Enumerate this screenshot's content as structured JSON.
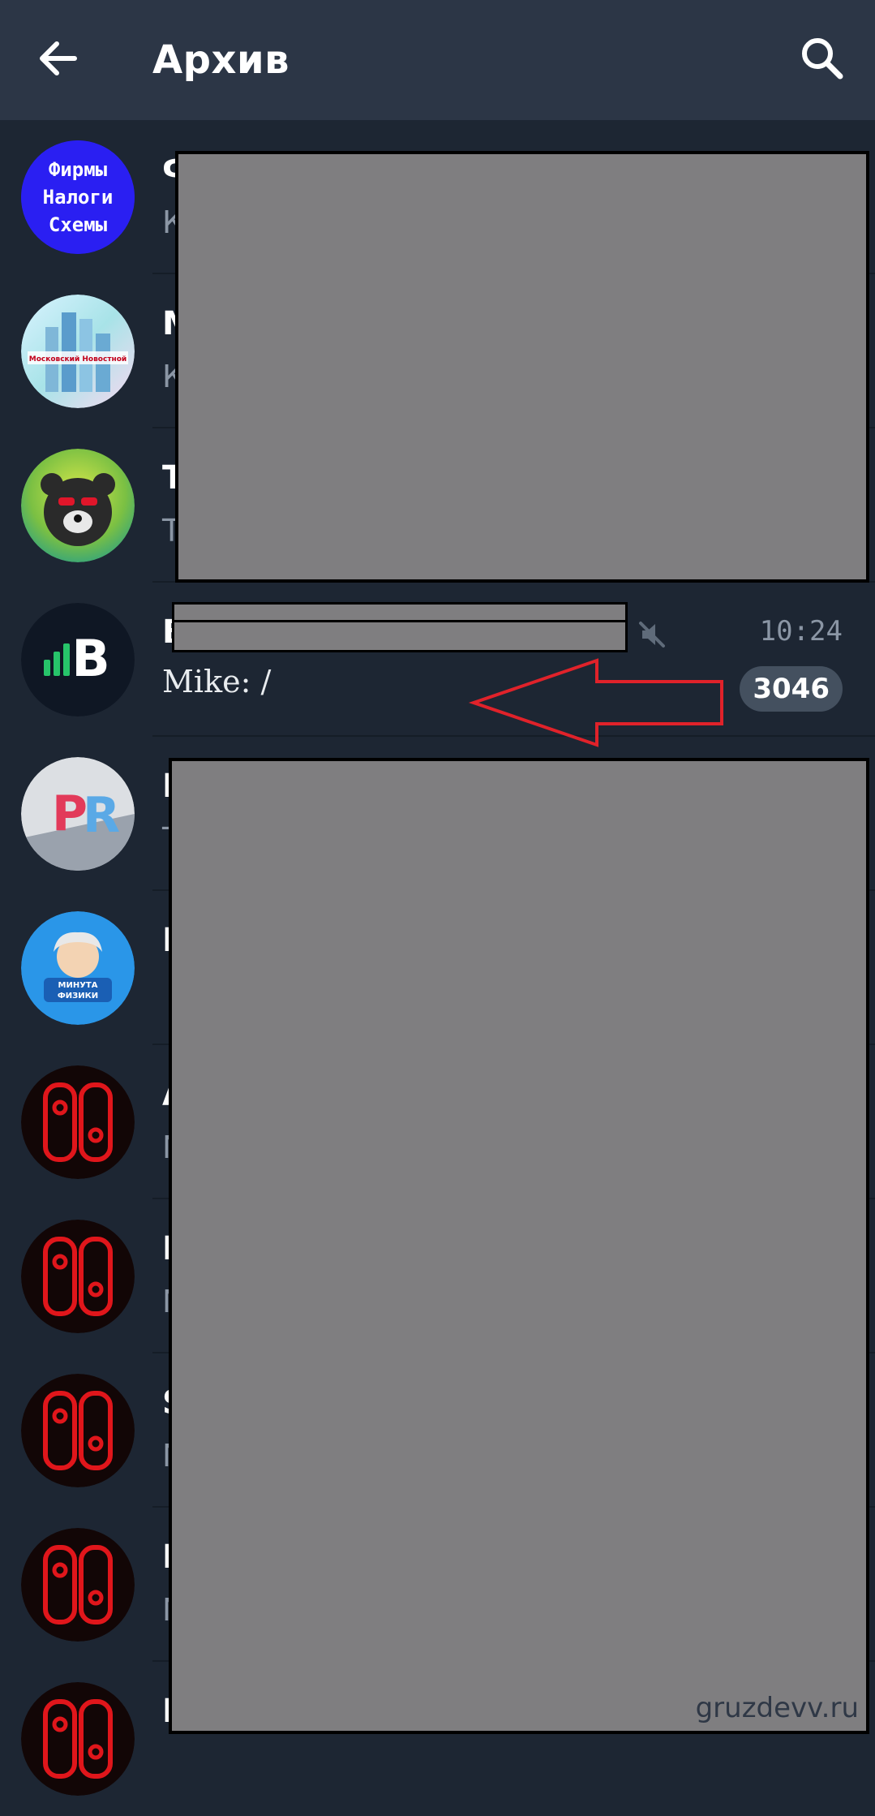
{
  "header": {
    "title": "Архив",
    "back_icon": "arrow-left-icon",
    "search_icon": "search-icon"
  },
  "chats": [
    {
      "avatar_lines": [
        "Фирмы",
        "Налоги",
        "Схемы"
      ],
      "avatar_color": "#2a1ff2",
      "title_initial": "Ф",
      "preview_initial": "К"
    },
    {
      "avatar_text": "Московский Новостной",
      "title_initial": "М",
      "preview_initial": "К"
    },
    {
      "avatar_icon": "bear-icon",
      "title_initial": "T",
      "preview_initial": "T"
    },
    {
      "avatar_letter": "B",
      "title_initial": "B",
      "time": "10:24",
      "preview": "Mike: /",
      "unread": "3046",
      "muted_icon": "muted-speaker-icon"
    },
    {
      "avatar_text": "PR",
      "title_initial": "I",
      "preview_initial": "T"
    },
    {
      "avatar_text": "МИНУТА ФИЗИКИ",
      "title_initial": "I"
    },
    {
      "avatar_icon": "switch-console-icon",
      "title_initial": "A",
      "preview_initial": "N"
    },
    {
      "avatar_icon": "switch-console-icon",
      "title_initial": "I",
      "preview_initial": "N"
    },
    {
      "avatar_icon": "switch-console-icon",
      "title_initial": "S",
      "preview_initial": "N"
    },
    {
      "avatar_icon": "switch-console-icon",
      "title_initial": "I",
      "preview_initial": "N"
    },
    {
      "avatar_icon": "switch-console-icon",
      "title_initial": "I"
    }
  ],
  "watermark": "gruzdevv.ru",
  "colors": {
    "background": "#1d2633",
    "header": "#2c3646",
    "redaction": "#7f7e80",
    "annotation_arrow": "#e0222a",
    "switch_red": "#e0161b"
  }
}
